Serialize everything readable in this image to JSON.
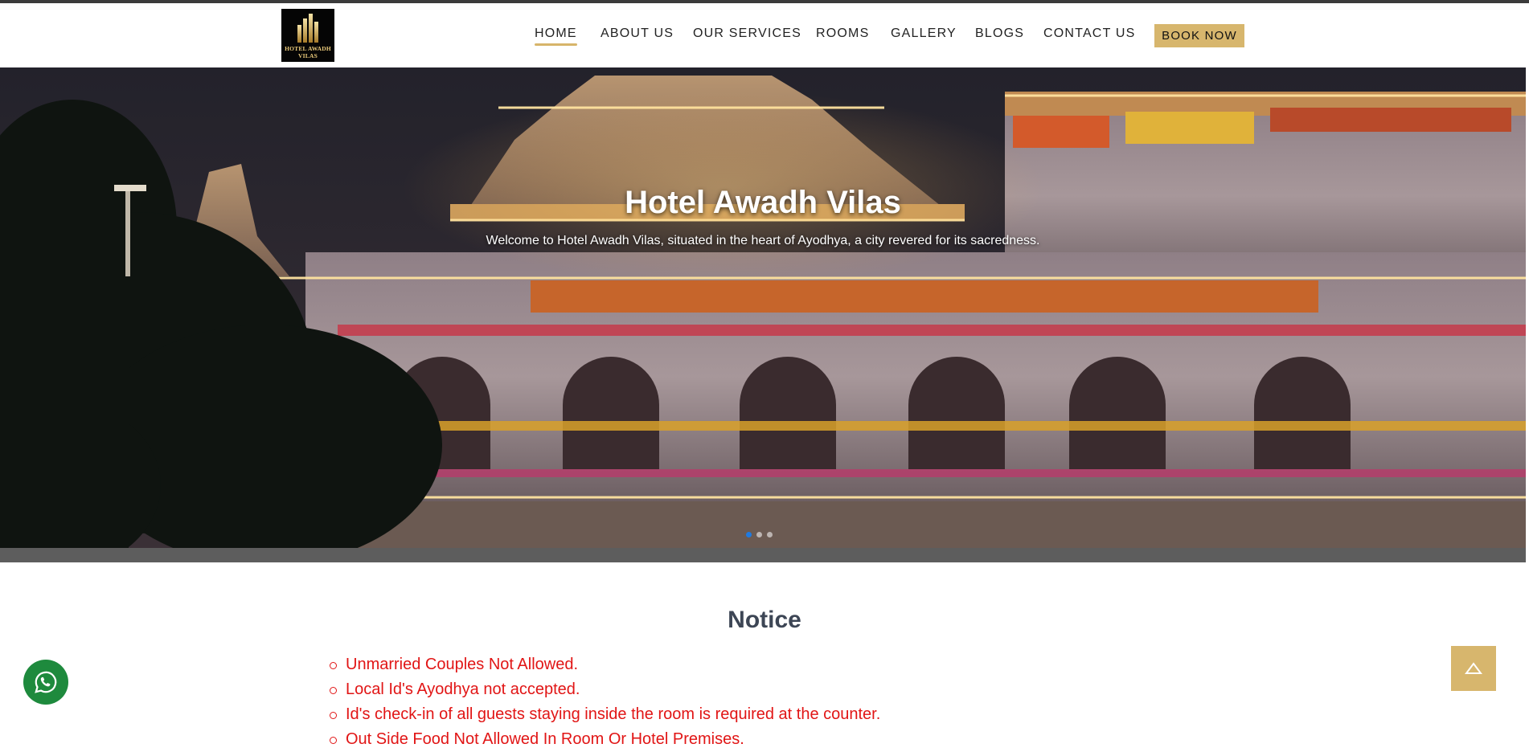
{
  "brand": {
    "logo_text_line1": "HOTEL AWADH",
    "logo_text_line2": "VILAS",
    "accent_color": "#d7b66d"
  },
  "nav": {
    "items": [
      {
        "label": "HOME",
        "active": true
      },
      {
        "label": "ABOUT US"
      },
      {
        "label": "OUR SERVICES"
      },
      {
        "label": "ROOMS"
      },
      {
        "label": "GALLERY"
      },
      {
        "label": "BLOGS"
      },
      {
        "label": "CONTACT US"
      }
    ],
    "book_now_label": "BOOK NOW"
  },
  "hero": {
    "title": "Hotel Awadh Vilas",
    "subtitle": "Welcome to Hotel Awadh Vilas, situated in the heart of Ayodhya, a city revered for its sacredness.",
    "slide_count": 3,
    "active_slide": 1
  },
  "notice": {
    "title": "Notice",
    "items": [
      "Unmarried Couples Not Allowed.",
      "Local Id's Ayodhya not accepted.",
      "Id's check-in of all guests staying inside the room is required at the counter.",
      "Out Side Food Not Allowed In Room Or Hotel Premises."
    ],
    "text_color": "#e11515"
  },
  "floating": {
    "whatsapp_icon": "whatsapp-icon",
    "whatsapp_color": "#1e8a3d",
    "scroll_top_icon": "arrow-up-icon"
  }
}
